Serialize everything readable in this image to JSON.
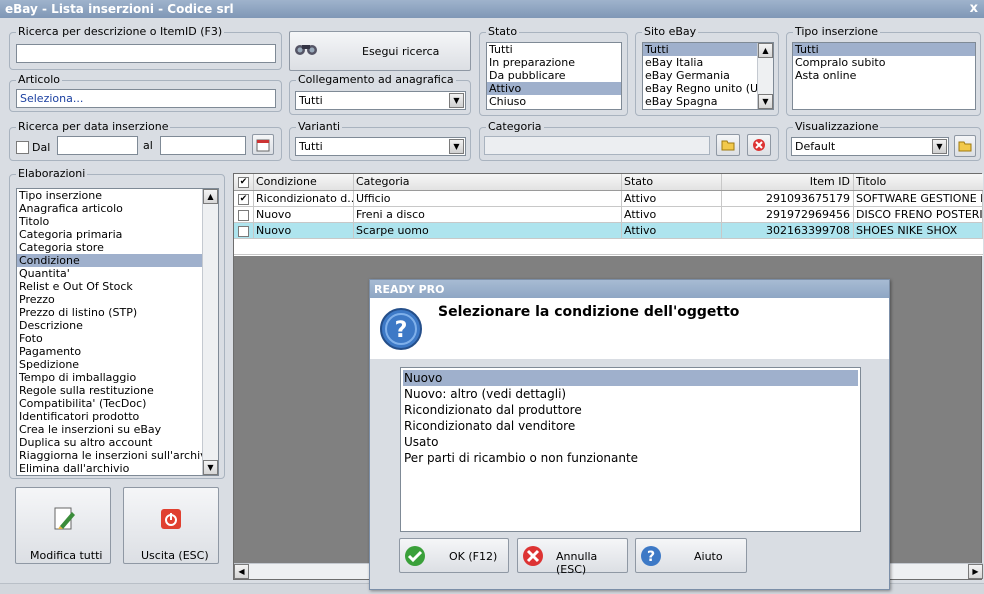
{
  "window": {
    "title": "eBay - Lista inserzioni - Codice srl",
    "close": "x"
  },
  "search": {
    "label": "Ricerca per descrizione o ItemID (F3)",
    "value": "",
    "button": "Esegui ricerca"
  },
  "articolo": {
    "label": "Articolo",
    "value": "Seleziona..."
  },
  "collegamento": {
    "label": "Collegamento ad anagrafica",
    "value": "Tutti"
  },
  "stato": {
    "label": "Stato",
    "items": [
      "Tutti",
      "In preparazione",
      "Da pubblicare",
      "Attivo",
      "Chiuso"
    ]
  },
  "sito": {
    "label": "Sito eBay",
    "items": [
      "Tutti",
      "eBay Italia",
      "eBay Germania",
      "eBay Regno unito (UK)",
      "eBay Spagna"
    ]
  },
  "tipo": {
    "label": "Tipo inserzione",
    "items": [
      "Tutti",
      "Compralo subito",
      "Asta online"
    ]
  },
  "data": {
    "label": "Ricerca per data inserzione",
    "dal": "Dal",
    "al": "al"
  },
  "varianti": {
    "label": "Varianti",
    "value": "Tutti"
  },
  "categoria": {
    "label": "Categoria",
    "value": ""
  },
  "visualizzazione": {
    "label": "Visualizzazione",
    "value": "Default"
  },
  "elaborazioni": {
    "label": "Elaborazioni",
    "items": [
      "Tipo inserzione",
      "Anagrafica articolo",
      "Titolo",
      "Categoria primaria",
      "Categoria store",
      "Condizione",
      "Quantita'",
      "Relist e Out Of Stock",
      "Prezzo",
      "Prezzo di listino (STP)",
      "Descrizione",
      "Foto",
      "Pagamento",
      "Spedizione",
      "Tempo di imballaggio",
      "Regole sulla restituzione",
      "Compatibilita' (TecDoc)",
      "Identificatori prodotto",
      "Crea le inserzioni su eBay",
      "Duplica su altro account",
      "Riaggiorna le inserzioni sull'archivio",
      "Elimina dall'archivio"
    ]
  },
  "actions": {
    "modifica": "Modifica tutti",
    "uscita": "Uscita (ESC)"
  },
  "grid": {
    "headers": [
      "Condizione",
      "Categoria",
      "Stato",
      "Item ID",
      "Titolo"
    ],
    "rows": [
      {
        "checked": "✔",
        "condizione": "Ricondizionato d...",
        "categoria": "Ufficio",
        "stato": "Attivo",
        "itemid": "291093675179",
        "titolo": "SOFTWARE GESTIONE NE"
      },
      {
        "checked": "",
        "condizione": "Nuovo",
        "categoria": "Freni a disco",
        "stato": "Attivo",
        "itemid": "291972969456",
        "titolo": "DISCO FRENO POSTERIOI"
      },
      {
        "checked": "",
        "condizione": "Nuovo",
        "categoria": "Scarpe uomo",
        "stato": "Attivo",
        "itemid": "302163399708",
        "titolo": "SHOES NIKE SHOX"
      }
    ]
  },
  "dialog": {
    "title": "READY PRO",
    "heading": "Selezionare la condizione dell'oggetto",
    "options": [
      "Nuovo",
      "Nuovo: altro (vedi dettagli)",
      "Ricondizionato dal produttore",
      "Ricondizionato dal venditore",
      "Usato",
      "Per parti di ricambio o non funzionante"
    ],
    "ok": "OK (F12)",
    "annulla": "Annulla (ESC)",
    "aiuto": "Aiuto"
  },
  "colors": {
    "selection": "#9fb0cc",
    "highlight_row": "#aee4ee",
    "titlebar": "#8ea6c4"
  }
}
